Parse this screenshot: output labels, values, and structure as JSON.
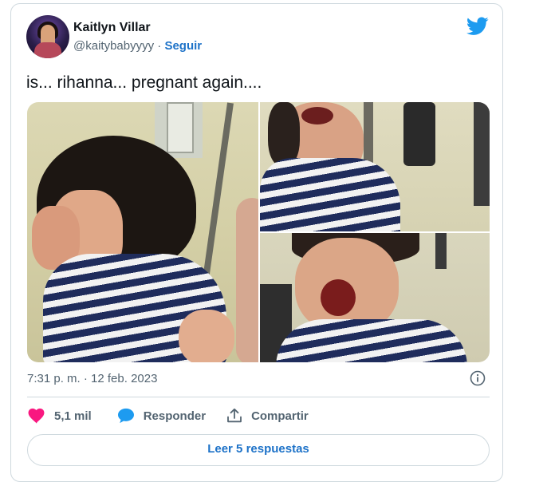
{
  "tweet": {
    "author": {
      "display_name": "Kaitlyn Villar",
      "handle": "@kaitybabyyyy",
      "separator": "·",
      "follow_label": "Seguir"
    },
    "text": "is... rihanna... pregnant again....",
    "timestamp": "7:31 p. m. · 12 feb. 2023",
    "likes_count": "5,1 mil",
    "reply_label": "Responder",
    "share_label": "Compartir",
    "read_replies_label": "Leer 5 respuestas",
    "media_count": 3
  },
  "icons": {
    "brand": "twitter-bird-icon",
    "info": "info-icon",
    "like": "heart-icon",
    "reply": "reply-bubble-icon",
    "share": "share-upload-icon"
  },
  "colors": {
    "brand_blue": "#1d9bf0",
    "link_blue": "#1d72c8",
    "like_pink": "#f91880",
    "text_primary": "#0f1419",
    "text_secondary": "#536471",
    "border": "#cfd9de"
  }
}
